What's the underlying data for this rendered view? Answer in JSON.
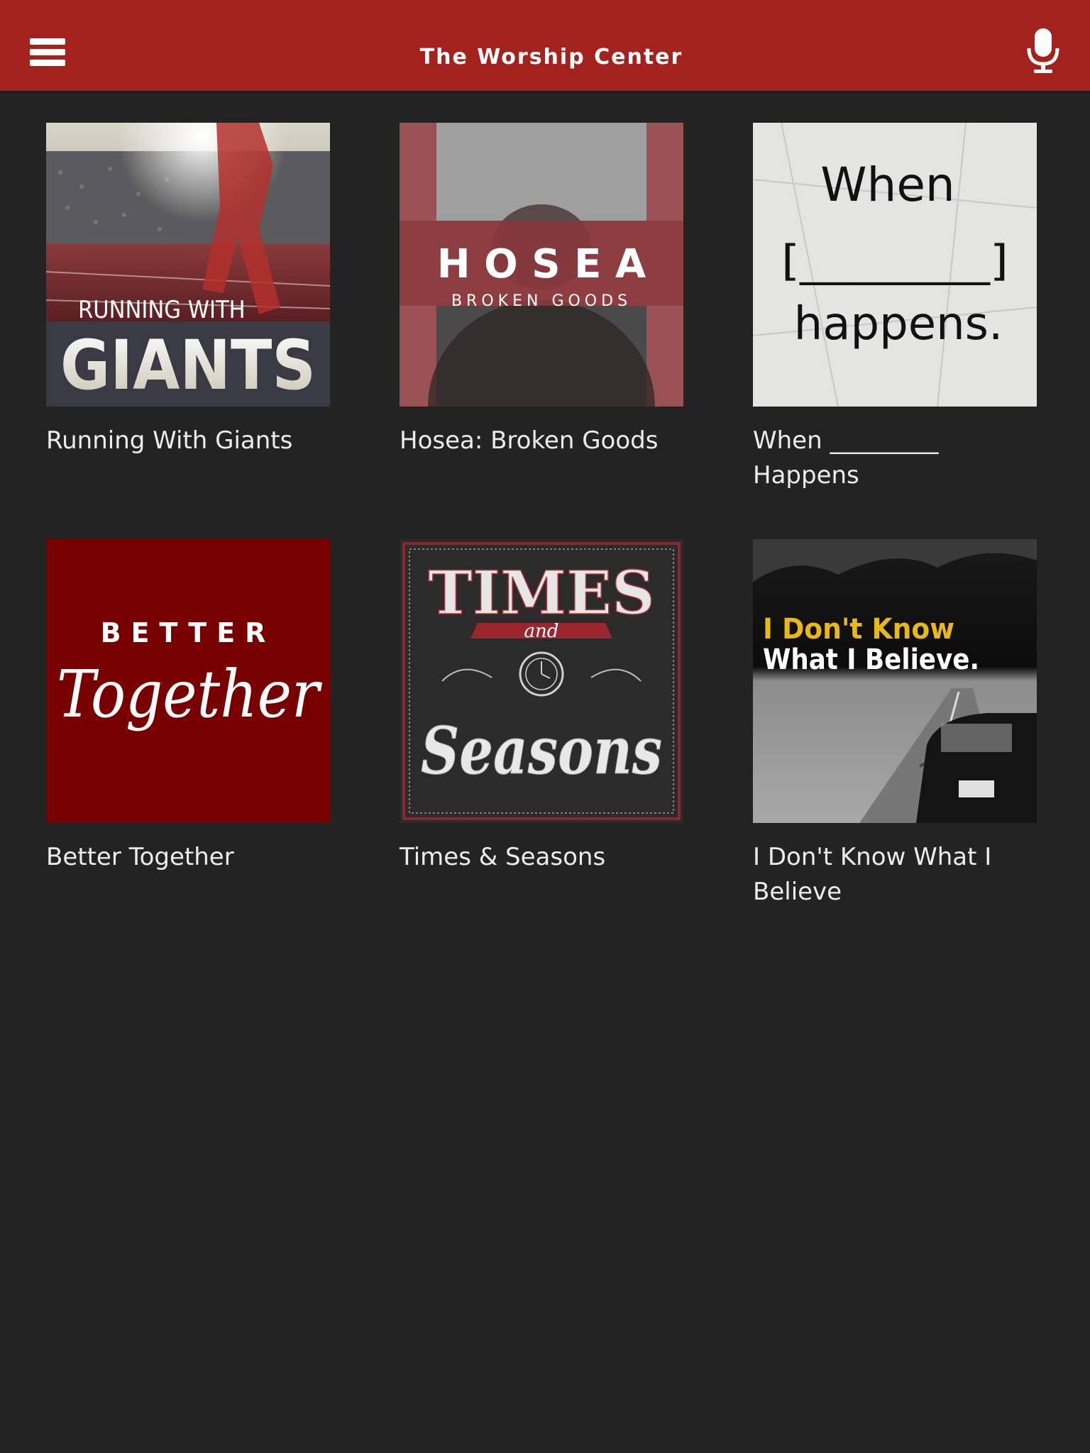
{
  "header": {
    "title": "The Worship Center",
    "menu_icon": "hamburger-menu-icon",
    "mic_icon": "microphone-icon",
    "background_color": "#a3221d"
  },
  "series": [
    {
      "label": "Running With Giants",
      "art_text_top": "RUNNING WITH",
      "art_text_main": "GIANTS"
    },
    {
      "label": "Hosea: Broken Goods",
      "art_text_main": "H O S E A",
      "art_text_sub": "BROKEN GOODS"
    },
    {
      "label": "When _________ Happens",
      "art_text_line1": "When",
      "art_text_line2": "[________]",
      "art_text_line3": "happens."
    },
    {
      "label": "Better Together",
      "art_text_top": "BETTER",
      "art_text_main": "Together"
    },
    {
      "label": "Times & Seasons",
      "art_text_top": "TIMES",
      "art_text_mid": "and",
      "art_text_main": "Seasons"
    },
    {
      "label": "I Don't Know What I Believe",
      "art_text_line1": "I Don't Know",
      "art_text_line2": "What I Believe."
    }
  ]
}
